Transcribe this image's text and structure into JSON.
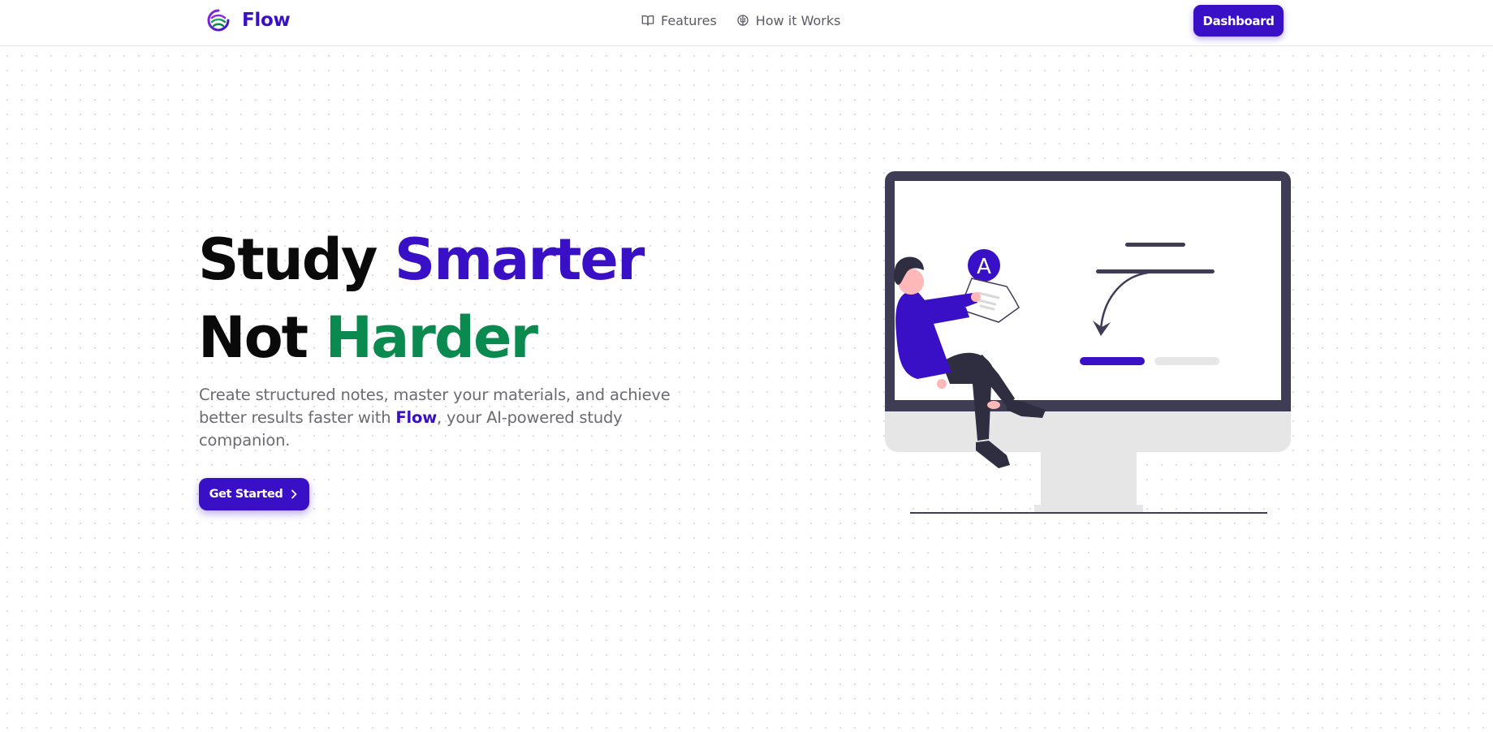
{
  "header": {
    "brand": {
      "name": "Flow",
      "logo_icon": "flow-swirl-logo"
    },
    "nav": [
      {
        "label": "Features",
        "icon": "book-open-icon"
      },
      {
        "label": "How it Works",
        "icon": "brain-icon"
      }
    ],
    "dashboard_label": "Dashboard"
  },
  "hero": {
    "title_line1_a": "Study",
    "title_line1_b": "Smarter",
    "title_line2_a": "Not",
    "title_line2_b": "Harder",
    "description_before": "Create structured notes, master your materials, and achieve better results faster with ",
    "description_brand": "Flow",
    "description_after": ", your AI-powered study companion.",
    "cta_label": "Get Started",
    "cta_icon": "chevron-right-icon"
  },
  "illustration": {
    "badge_letter": "A"
  },
  "colors": {
    "primary": "#3a10c7",
    "accent_green": "#0b8a4f",
    "monitor_frame": "#3f3d56",
    "muted_text": "#6b6b72"
  }
}
